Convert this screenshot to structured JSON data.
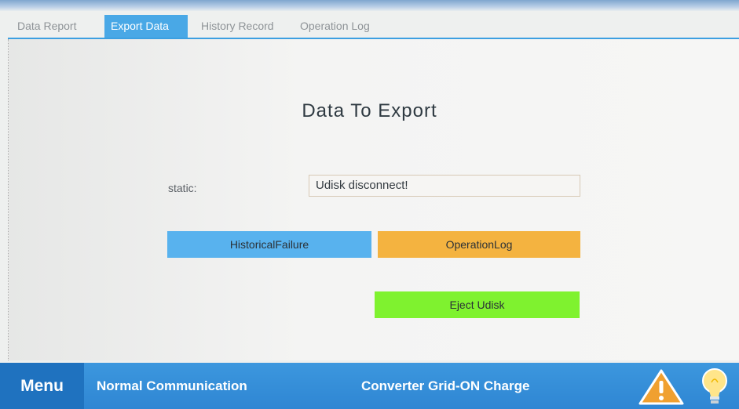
{
  "tabs": [
    {
      "label": "Data Report",
      "active": false
    },
    {
      "label": "Export Data",
      "active": true
    },
    {
      "label": "History Record",
      "active": false
    },
    {
      "label": "Operation Log",
      "active": false
    }
  ],
  "main": {
    "title": "Data To Export",
    "static_label": "static:",
    "status_value": "Udisk disconnect!",
    "buttons": {
      "historical_failure": "HistoricalFailure",
      "operation_log": "OperationLog",
      "eject_udisk": "Eject Udisk"
    }
  },
  "footer": {
    "menu_label": "Menu",
    "communication_status": "Normal Communication",
    "converter_status": "Converter Grid-ON Charge",
    "warning_icon": "warning-triangle-icon",
    "bulb_icon": "lightbulb-icon"
  },
  "colors": {
    "accent_blue": "#49a8e6",
    "footer_blue": "#2f86d3",
    "historical_button": "#58b2ee",
    "operation_button": "#f4b340",
    "eject_button": "#7ff22f",
    "warning_orange": "#f0a030"
  }
}
